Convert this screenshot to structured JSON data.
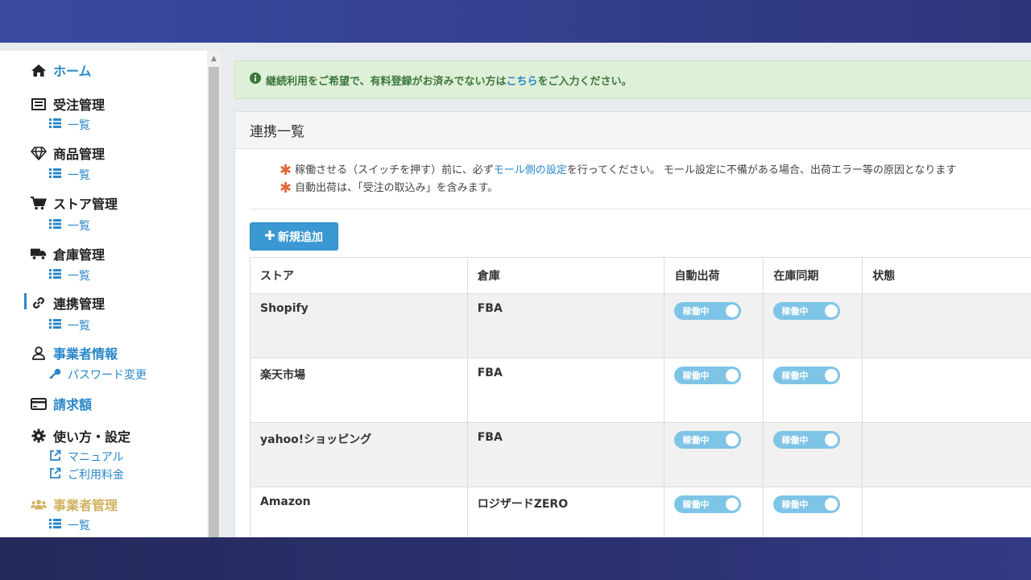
{
  "sidebar": {
    "home": "ホーム",
    "orders": "受注管理",
    "orders_list": "一覧",
    "products": "商品管理",
    "products_list": "一覧",
    "stores": "ストア管理",
    "stores_list": "一覧",
    "warehouses": "倉庫管理",
    "warehouses_list": "一覧",
    "integrations": "連携管理",
    "integrations_list": "一覧",
    "business_info": "事業者情報",
    "password_change": "パスワード変更",
    "billing": "請求額",
    "usage_settings": "使い方・設定",
    "manual": "マニュアル",
    "pricing": "ご利用料金",
    "business_mgmt": "事業者管理",
    "business_mgmt_list": "一覧"
  },
  "alert": {
    "text_before": "継続利用をご希望で、有料登録がお済みでない方は",
    "link": "こちら",
    "text_after": "をご入力ください。"
  },
  "panel": {
    "title": "連携一覧",
    "note1_before": "稼働させる（スイッチを押す）前に、必ず",
    "note1_link": "モール側の設定",
    "note1_after": "を行ってください。 モール設定に不備がある場合、出荷エラー等の原因となります",
    "note2": "自動出荷は、「受注の取込み」を含みます。",
    "new_button": "新規追加"
  },
  "table": {
    "headers": [
      "ストア",
      "倉庫",
      "自動出荷",
      "在庫同期",
      "状態"
    ],
    "rows": [
      {
        "store": "Shopify",
        "warehouse": "FBA",
        "auto_ship": "稼働中",
        "stock_sync": "稼働中",
        "status": ""
      },
      {
        "store": "楽天市場",
        "warehouse": "FBA",
        "auto_ship": "稼働中",
        "stock_sync": "稼働中",
        "status": ""
      },
      {
        "store": "yahoo!ショッピング",
        "warehouse": "FBA",
        "auto_ship": "稼働中",
        "stock_sync": "稼働中",
        "status": ""
      },
      {
        "store": "Amazon",
        "warehouse": "ロジザードZERO",
        "auto_ship": "稼働中",
        "stock_sync": "稼働中",
        "status": ""
      }
    ]
  },
  "colors": {
    "accent": "#2a87c8",
    "toggle_on": "#7ec4e6",
    "alert_bg": "#dff0d8",
    "gold": "#d1b261",
    "asterisk": "#e2693b"
  }
}
